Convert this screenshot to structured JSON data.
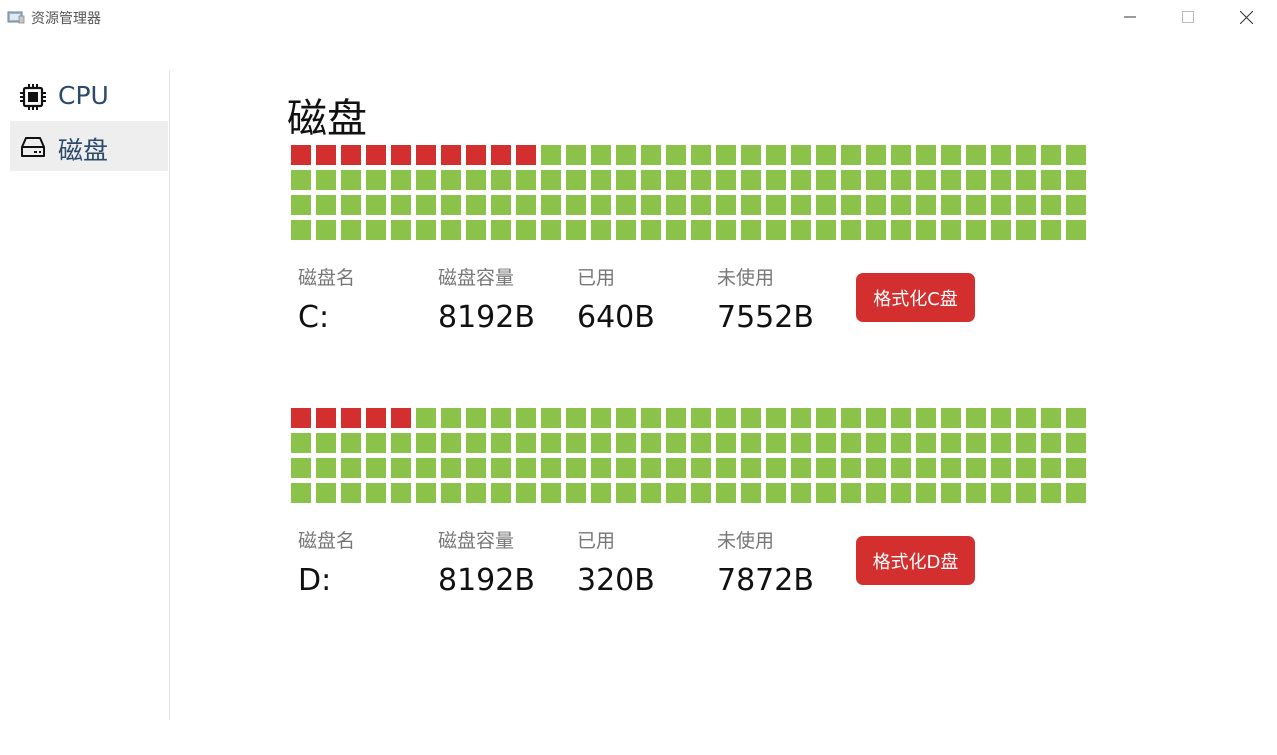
{
  "window": {
    "title": "资源管理器",
    "icon": "folder-computer-icon"
  },
  "sidebar": {
    "items": [
      {
        "label": "CPU",
        "icon": "cpu-chip-icon",
        "active": false
      },
      {
        "label": "磁盘",
        "icon": "hard-drive-icon",
        "active": true
      }
    ]
  },
  "page": {
    "title": "磁盘"
  },
  "labels": {
    "name": "磁盘名",
    "capacity": "磁盘容量",
    "used": "已用",
    "free": "未使用"
  },
  "disks": [
    {
      "name": "C:",
      "capacity": "8192B",
      "used": "640B",
      "free": "7552B",
      "format_label": "格式化C盘",
      "block_grid": {
        "columns": 32,
        "rows": 4,
        "used_blocks": 10
      }
    },
    {
      "name": "D:",
      "capacity": "8192B",
      "used": "320B",
      "free": "7872B",
      "format_label": "格式化D盘",
      "block_grid": {
        "columns": 32,
        "rows": 4,
        "used_blocks": 5
      }
    }
  ],
  "colors": {
    "used_block": "#d32f2f",
    "free_block": "#8bc34a",
    "format_button": "#d32f2f",
    "nav_text": "#2b4a6b"
  }
}
